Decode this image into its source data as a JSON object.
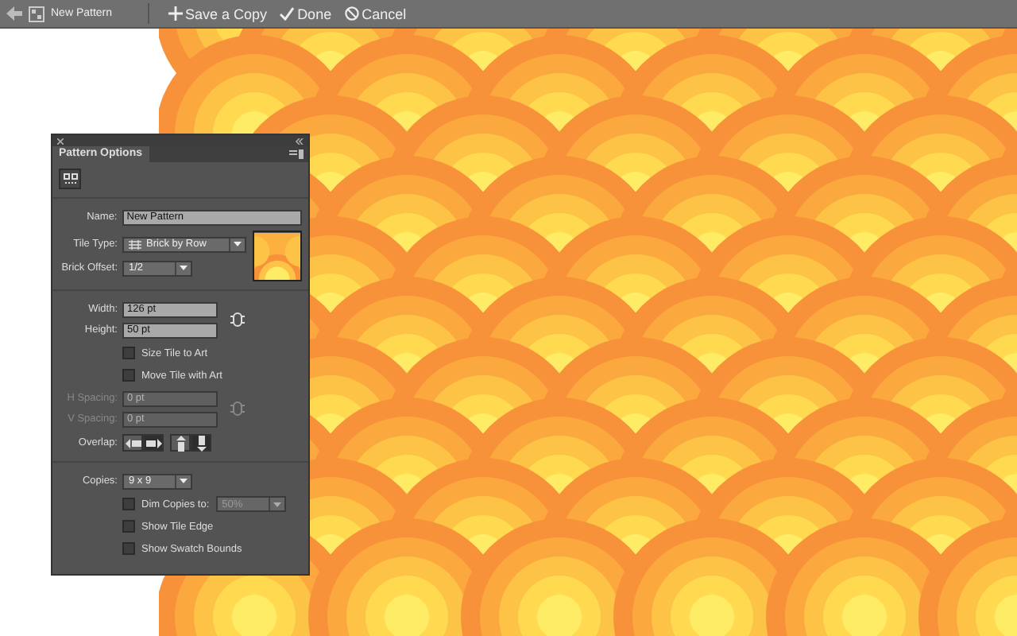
{
  "toolbar": {
    "title": "New Pattern",
    "actions": [
      {
        "kind": "add",
        "label": "Save a Copy"
      },
      {
        "kind": "done",
        "label": "Done"
      },
      {
        "kind": "cancel",
        "label": "Cancel"
      }
    ]
  },
  "panel": {
    "title": "Pattern Options",
    "name": {
      "label": "Name:",
      "value": "New Pattern"
    },
    "tile_type": {
      "label": "Tile Type:",
      "value": "Brick by Row"
    },
    "brick_offset": {
      "label": "Brick Offset:",
      "value": "1/2"
    },
    "size": [
      {
        "label": "Width:",
        "value": "126 pt"
      },
      {
        "label": "Height:",
        "value": "50 pt"
      }
    ],
    "tile_checks": [
      {
        "label": "Size Tile to Art",
        "checked": false
      },
      {
        "label": "Move Tile with Art",
        "checked": false
      }
    ],
    "spacing": [
      {
        "label": "H Spacing:",
        "value": "0 pt",
        "disabled": true
      },
      {
        "label": "V Spacing:",
        "value": "0 pt",
        "disabled": true
      }
    ],
    "overlap": {
      "label": "Overlap:",
      "buttons": [
        {
          "kind": "left",
          "selected": false
        },
        {
          "kind": "right",
          "selected": true
        },
        {
          "kind": "top",
          "selected": false
        },
        {
          "kind": "bottom",
          "selected": true
        }
      ]
    },
    "copies": {
      "label": "Copies:",
      "value": "9 x 9"
    },
    "dim": {
      "label": "Dim Copies to:",
      "checked": false,
      "value": "50%",
      "disabled": true
    },
    "bottom_checks": [
      {
        "label": "Show Tile Edge",
        "checked": false
      },
      {
        "label": "Show Swatch Bounds",
        "checked": false
      }
    ]
  }
}
